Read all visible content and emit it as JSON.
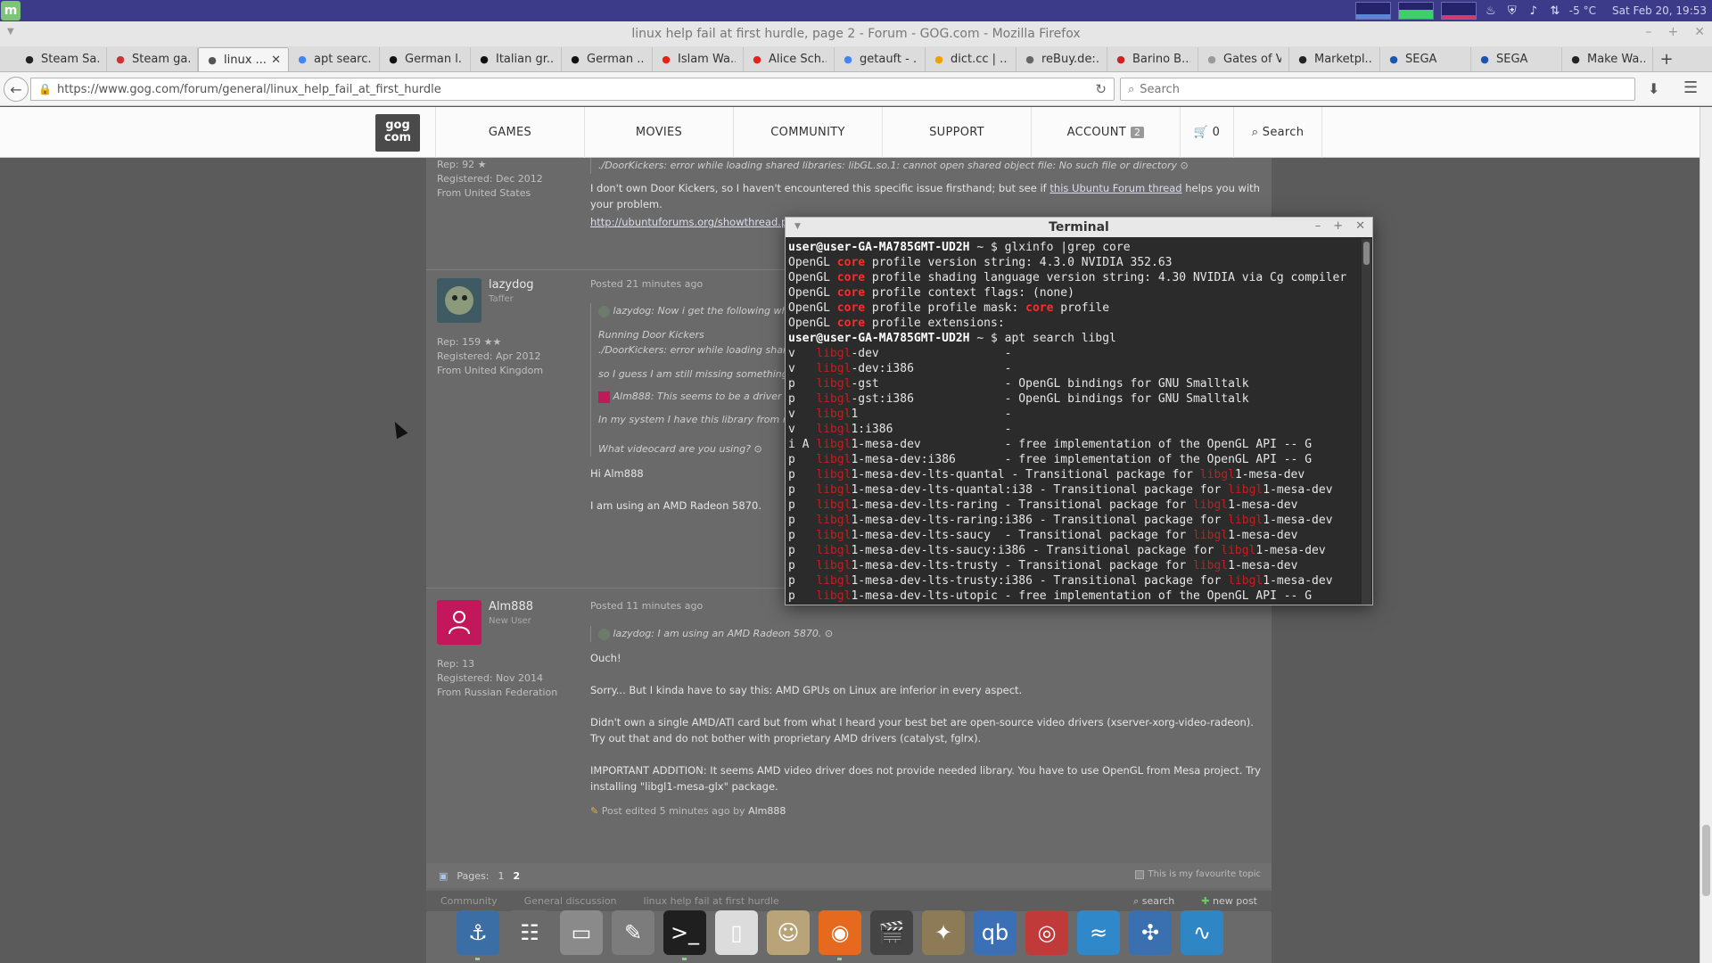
{
  "system_panel": {
    "menu_icon": "mint-menu-icon",
    "weather": "-5 °C",
    "datetime": "Sat Feb 20, 19:53"
  },
  "window": {
    "title": "linux help fail at first hurdle, page 2 - Forum - GOG.com - Mozilla Firefox"
  },
  "tabs": [
    {
      "label": "Steam Sa...",
      "favicon": "steam-icon",
      "fav_color": "#222"
    },
    {
      "label": "Steam ga...",
      "favicon": "steam-icon",
      "fav_color": "#c33"
    },
    {
      "label": "linux ...",
      "favicon": "gog-icon",
      "fav_color": "#555",
      "active": true
    },
    {
      "label": "apt searc...",
      "favicon": "google-icon",
      "fav_color": "#4285f4"
    },
    {
      "label": "German l...",
      "favicon": "wikipedia-icon",
      "fav_color": "#111"
    },
    {
      "label": "Italian gr...",
      "favicon": "wikipedia-icon",
      "fav_color": "#111"
    },
    {
      "label": "German ...",
      "favicon": "wikipedia-icon",
      "fav_color": "#111"
    },
    {
      "label": "Islam Wa...",
      "favicon": "youtube-icon",
      "fav_color": "#e62117"
    },
    {
      "label": "Alice Sch...",
      "favicon": "youtube-icon",
      "fav_color": "#e62117"
    },
    {
      "label": "getauft - ...",
      "favicon": "google-icon",
      "fav_color": "#4285f4"
    },
    {
      "label": "dict.cc | ...",
      "favicon": "dictcc-icon",
      "fav_color": "#f0a000"
    },
    {
      "label": "reBuy.de:...",
      "favicon": "rebuy-icon",
      "fav_color": "#666"
    },
    {
      "label": "Barino B...",
      "favicon": "barino-icon",
      "fav_color": "#c22"
    },
    {
      "label": "Gates of Vien...",
      "favicon": "",
      "fav_color": "#999"
    },
    {
      "label": "Marketpl...",
      "favicon": "marketplace-icon",
      "fav_color": "#222"
    },
    {
      "label": "SEGA",
      "favicon": "sega-icon",
      "fav_color": "#1a56b0"
    },
    {
      "label": "SEGA",
      "favicon": "sega-icon",
      "fav_color": "#1a56b0"
    },
    {
      "label": "Make Wa...",
      "favicon": "medium-icon",
      "fav_color": "#222"
    }
  ],
  "nav": {
    "url": "https://www.gog.com/forum/general/linux_help_fail_at_first_hurdle",
    "search_placeholder": "Search"
  },
  "gog_nav": {
    "logo_line1": "gog",
    "logo_line2": "com",
    "games": "GAMES",
    "movies": "MOVIES",
    "community": "COMMUNITY",
    "support": "SUPPORT",
    "account": "ACCOUNT",
    "account_badge": "2",
    "cart_count": "0",
    "search": "Search"
  },
  "posts": [
    {
      "rep": "Rep: 92 ★",
      "registered": "Registered: Dec 2012",
      "from": "From United States",
      "quote_error": "./DoorKickers: error while loading shared libraries: libGL.so.1: cannot open shared object file: No such file or directory",
      "body_start": "I don't own Door Kickers, so I haven't encountered this specific issue firsthand; but see if ",
      "body_link": "this Ubuntu Forum thread",
      "body_end": " helps you with your problem.",
      "url": "http://ubuntuforums.org/showthread.php"
    },
    {
      "user": "lazydog",
      "role": "Taffer",
      "rep": "Rep: 159 ★★",
      "registered": "Registered: Apr 2012",
      "from": "From United Kingdom",
      "posted": "Posted 21 minutes ago",
      "q1": "lazydog: Now i get the following when",
      "q2": "Running Door Kickers",
      "q3": "./DoorKickers: error while loading shared",
      "q4": "so I guess I am still missing something to",
      "q5": "Alm888: This seems to be a driver prob",
      "q6": "In my system I have this library from nVidia",
      "q7": "What videocard are you using?",
      "p1": "Hi Alm888",
      "p2": "I am using an AMD Radeon 5870."
    },
    {
      "user": "Alm888",
      "role": "New User",
      "rep": "Rep: 13",
      "registered": "Registered: Nov 2014",
      "from": "From Russian Federation",
      "posted": "Posted 11 minutes ago",
      "quote": "lazydog: I am using an AMD Radeon 5870.",
      "p1": "Ouch!",
      "p2": "Sorry... But I kinda have to say this: AMD GPUs on Linux are inferior in every aspect.",
      "p3": "Didn't own a single AMD/ATI card but from what I heard your best bet are open-source video drivers (xserver-xorg-video-radeon). Try out that and do not bother with proprietary AMD drivers (catalyst, fglrx).",
      "p4": "IMPORTANT ADDITION: It seems AMD video driver does not provide needed library. You have to use OpenGL from Mesa project. Try installing \"libgl1-mesa-glx\" package.",
      "edited": "Post edited 5 minutes ago by ",
      "edited_by": "Alm888"
    }
  ],
  "pager": {
    "label": "Pages:",
    "page1": "1",
    "page2": "2",
    "fav_topic": "This is my favourite topic"
  },
  "breadcrumb": {
    "b1": "Community",
    "b2": "General discussion",
    "b3": "linux help fail at first hurdle",
    "search": "search",
    "new": "new post"
  },
  "terminal": {
    "title": "Terminal",
    "prompt": "user@user-GA-MA785GMT-UD2H",
    "cmd1": "glxinfo |grep core",
    "glx_lines": [
      {
        "pre": "OpenGL ",
        "hl": "core",
        "post": " profile version string: 4.3.0 NVIDIA 352.63"
      },
      {
        "pre": "OpenGL ",
        "hl": "core",
        "post": " profile shading language version string: 4.30 NVIDIA via Cg compiler"
      },
      {
        "pre": "OpenGL ",
        "hl": "core",
        "post": " profile context flags: (none)"
      },
      {
        "pre": "OpenGL ",
        "hl": "core",
        "post": " profile profile mask: ",
        "hl2": "core",
        "post2": " profile"
      },
      {
        "pre": "OpenGL ",
        "hl": "core",
        "post": " profile extensions:"
      }
    ],
    "cmd2": "apt search libgl",
    "apt_lines": [
      {
        "state": "v  ",
        "rest": "-dev",
        "desc": "-"
      },
      {
        "state": "v  ",
        "rest": "-dev:i386",
        "desc": "-"
      },
      {
        "state": "p  ",
        "rest": "-gst",
        "desc": "- OpenGL bindings for GNU Smalltalk"
      },
      {
        "state": "p  ",
        "rest": "-gst:i386",
        "desc": "- OpenGL bindings for GNU Smalltalk"
      },
      {
        "state": "v  ",
        "rest": "1",
        "desc": "-"
      },
      {
        "state": "v  ",
        "rest": "1:i386",
        "desc": "-"
      },
      {
        "state": "i A",
        "rest": "1-mesa-dev",
        "desc": "- free implementation of the OpenGL API -- G"
      },
      {
        "state": "p  ",
        "rest": "1-mesa-dev:i386",
        "desc": "- free implementation of the OpenGL API -- G"
      },
      {
        "state": "p  ",
        "rest": "1-mesa-dev-lts-quantal",
        "desc": "- Transitional package for ",
        "desc_hl": "libgl",
        "desc_end": "1-mesa-dev"
      },
      {
        "state": "p  ",
        "rest": "1-mesa-dev-lts-quantal:i38",
        "desc": "- Transitional package for ",
        "desc_hl": "libgl",
        "desc_end": "1-mesa-dev"
      },
      {
        "state": "p  ",
        "rest": "1-mesa-dev-lts-raring",
        "desc": "- Transitional package for ",
        "desc_hl": "libgl",
        "desc_end": "1-mesa-dev"
      },
      {
        "state": "p  ",
        "rest": "1-mesa-dev-lts-raring:i386",
        "desc": "- Transitional package for ",
        "desc_hl": "libgl",
        "desc_end": "1-mesa-dev"
      },
      {
        "state": "p  ",
        "rest": "1-mesa-dev-lts-saucy",
        "desc": "- Transitional package for ",
        "desc_hl": "libgl",
        "desc_end": "1-mesa-dev"
      },
      {
        "state": "p  ",
        "rest": "1-mesa-dev-lts-saucy:i386",
        "desc": "- Transitional package for ",
        "desc_hl": "libgl",
        "desc_end": "1-mesa-dev"
      },
      {
        "state": "p  ",
        "rest": "1-mesa-dev-lts-trusty",
        "desc": "- Transitional package for ",
        "desc_hl": "libgl",
        "desc_end": "1-mesa-dev"
      },
      {
        "state": "p  ",
        "rest": "1-mesa-dev-lts-trusty:i386",
        "desc": "- Transitional package for ",
        "desc_hl": "libgl",
        "desc_end": "1-mesa-dev"
      },
      {
        "state": "p  ",
        "rest": "1-mesa-dev-lts-utopic",
        "desc": "- free implementation of the OpenGL API -- G"
      }
    ],
    "match": "libgl"
  },
  "dock": [
    {
      "name": "anchor-dock-icon",
      "glyph": "⚓",
      "bg": "#3a6ea5",
      "running": true
    },
    {
      "name": "mixer-dock-icon",
      "glyph": "☷",
      "bg": "#6a6a6a"
    },
    {
      "name": "drive-dock-icon",
      "glyph": "▭",
      "bg": "#8a8a8a"
    },
    {
      "name": "settings-dock-icon",
      "glyph": "✎",
      "bg": "#7c7c7c"
    },
    {
      "name": "terminal-dock-icon",
      "glyph": ">_",
      "bg": "#1f1f1f",
      "running": true
    },
    {
      "name": "files-dock-icon",
      "glyph": "▯",
      "bg": "#dcdcdc"
    },
    {
      "name": "gimp-dock-icon",
      "glyph": "☺",
      "bg": "#b9a47a"
    },
    {
      "name": "firefox-dock-icon",
      "glyph": "◉",
      "bg": "#e66a1e",
      "running": true
    },
    {
      "name": "clapper-dock-icon",
      "glyph": "🎬",
      "bg": "#444"
    },
    {
      "name": "gimp2-dock-icon",
      "glyph": "✦",
      "bg": "#8d7a57"
    },
    {
      "name": "qbittorrent-dock-icon",
      "glyph": "qb",
      "bg": "#3b6fb6"
    },
    {
      "name": "disc-dock-icon",
      "glyph": "◎",
      "bg": "#c03a3a"
    },
    {
      "name": "dolphin-dock-icon",
      "glyph": "≈",
      "bg": "#2f88c9"
    },
    {
      "name": "network-dock-icon",
      "glyph": "✣",
      "bg": "#3a6fb0"
    },
    {
      "name": "monitor-dock-icon",
      "glyph": "∿",
      "bg": "#2f86c5"
    }
  ]
}
